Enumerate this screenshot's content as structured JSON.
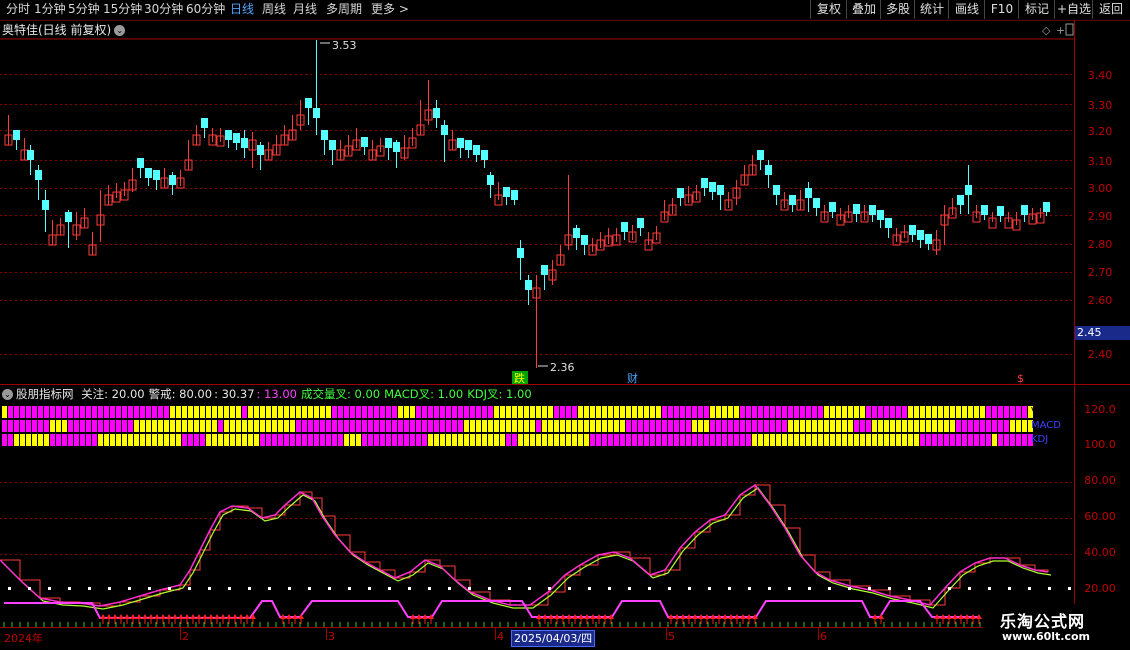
{
  "toolbar": {
    "periods": [
      "分时",
      "1分钟",
      "5分钟",
      "15分钟",
      "30分钟",
      "60分钟",
      "日线",
      "周线",
      "月线",
      "多周期",
      "更多 >"
    ],
    "active_period": "日线",
    "right_buttons": [
      "复权",
      "叠加",
      "多股",
      "统计",
      "画线",
      "F10",
      "标记",
      "+自选",
      "返回"
    ]
  },
  "main_chart": {
    "title": "奥特佳(日线 前复权)",
    "y_labels": [
      "3.40",
      "3.30",
      "3.20",
      "3.10",
      "3.00",
      "2.90",
      "2.80",
      "2.70",
      "2.60",
      "2.40"
    ],
    "current_price": "2.45",
    "high_label": "3.53",
    "low_label": "2.36",
    "markers": [
      "跌",
      "财",
      "$"
    ]
  },
  "indicator": {
    "name": "股朋指标网",
    "params": [
      {
        "label": "关注:",
        "value": "20.00",
        "color": "#e6e6e6"
      },
      {
        "label": "警戒:",
        "value": "80.00",
        "color": "#e6e6e6"
      },
      {
        "label": ":",
        "value": "30.37",
        "color": "#e6e6e6"
      },
      {
        "label": ":",
        "value": "13.00",
        "color": "#ff40ff"
      },
      {
        "label": "成交量叉:",
        "value": "0.00",
        "color": "#40ff40"
      },
      {
        "label": "MACD叉:",
        "value": "1.00",
        "color": "#40ff40"
      },
      {
        "label": "KDJ叉:",
        "value": "1.00",
        "color": "#40ff40"
      }
    ],
    "band_labels": [
      "VOL",
      "MACD",
      "KDJ"
    ],
    "y_labels": [
      "120.0",
      "100.0",
      "80.00",
      "60.00",
      "40.00",
      "20.00"
    ]
  },
  "x_axis": {
    "labels": [
      "2024年",
      "2",
      "3",
      "4",
      "5",
      "6"
    ],
    "highlight_date": "2025/04/03/四"
  },
  "watermark": {
    "line1": "乐淘公式网",
    "line2": "www.60lt.com"
  },
  "colors": {
    "up": "#ff3b3b",
    "down": "#54ffff",
    "yellow": "#ffff00",
    "magenta": "#ff00ff",
    "grid": "#a00000"
  }
}
